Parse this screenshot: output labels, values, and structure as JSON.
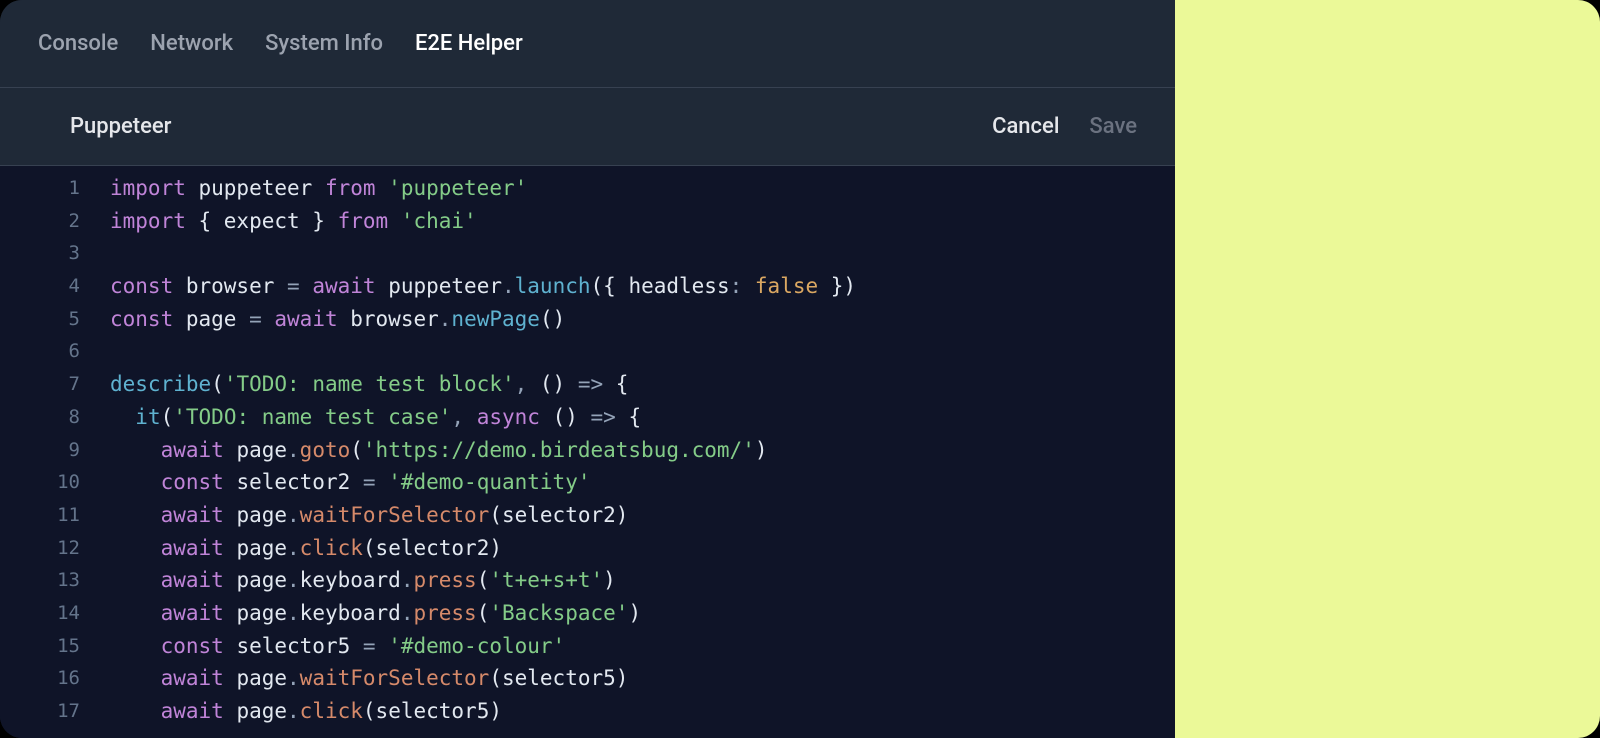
{
  "tabs": {
    "console": "Console",
    "network": "Network",
    "sysinfo": "System Info",
    "e2e": "E2E Helper",
    "activeIndex": 3
  },
  "toolbar": {
    "title": "Puppeteer",
    "cancel": "Cancel",
    "save": "Save"
  },
  "code": {
    "lineNumbers": [
      "1",
      "2",
      "3",
      "4",
      "5",
      "6",
      "7",
      "8",
      "9",
      "10",
      "11",
      "12",
      "13",
      "14",
      "15",
      "16",
      "17"
    ],
    "tokens": [
      [
        [
          "kw",
          "import"
        ],
        [
          "id",
          " puppeteer "
        ],
        [
          "kw",
          "from"
        ],
        [
          "id",
          " "
        ],
        [
          "str",
          "'puppeteer'"
        ]
      ],
      [
        [
          "kw",
          "import"
        ],
        [
          "id",
          " { expect } "
        ],
        [
          "kw",
          "from"
        ],
        [
          "id",
          " "
        ],
        [
          "str",
          "'chai'"
        ]
      ],
      [],
      [
        [
          "kw",
          "const"
        ],
        [
          "id",
          " browser "
        ],
        [
          "op",
          "="
        ],
        [
          "id",
          " "
        ],
        [
          "kw",
          "await"
        ],
        [
          "id",
          " puppeteer"
        ],
        [
          "op",
          "."
        ],
        [
          "fn",
          "launch"
        ],
        [
          "paren",
          "({ "
        ],
        [
          "id",
          "headless"
        ],
        [
          "op",
          ":"
        ],
        [
          "id",
          " "
        ],
        [
          "bool",
          "false"
        ],
        [
          "paren",
          " })"
        ]
      ],
      [
        [
          "kw",
          "const"
        ],
        [
          "id",
          " page "
        ],
        [
          "op",
          "="
        ],
        [
          "id",
          " "
        ],
        [
          "kw",
          "await"
        ],
        [
          "id",
          " browser"
        ],
        [
          "op",
          "."
        ],
        [
          "fn",
          "newPage"
        ],
        [
          "paren",
          "()"
        ]
      ],
      [],
      [
        [
          "fn",
          "describe"
        ],
        [
          "paren",
          "("
        ],
        [
          "str",
          "'TODO: name test block'"
        ],
        [
          "op",
          ","
        ],
        [
          "paren",
          " () "
        ],
        [
          "op",
          "=>"
        ],
        [
          "paren",
          " {"
        ]
      ],
      [
        [
          "id",
          "  "
        ],
        [
          "fn",
          "it"
        ],
        [
          "paren",
          "("
        ],
        [
          "str",
          "'TODO: name test case'"
        ],
        [
          "op",
          ","
        ],
        [
          "id",
          " "
        ],
        [
          "kw",
          "async"
        ],
        [
          "paren",
          " () "
        ],
        [
          "op",
          "=>"
        ],
        [
          "paren",
          " {"
        ]
      ],
      [
        [
          "id",
          "    "
        ],
        [
          "kw",
          "await"
        ],
        [
          "id",
          " page"
        ],
        [
          "op",
          "."
        ],
        [
          "method",
          "goto"
        ],
        [
          "paren",
          "("
        ],
        [
          "str",
          "'https://demo.birdeatsbug.com/'"
        ],
        [
          "paren",
          ")"
        ]
      ],
      [
        [
          "id",
          "    "
        ],
        [
          "kw",
          "const"
        ],
        [
          "id",
          " selector2 "
        ],
        [
          "op",
          "="
        ],
        [
          "id",
          " "
        ],
        [
          "str",
          "'#demo-quantity'"
        ]
      ],
      [
        [
          "id",
          "    "
        ],
        [
          "kw",
          "await"
        ],
        [
          "id",
          " page"
        ],
        [
          "op",
          "."
        ],
        [
          "method",
          "waitForSelector"
        ],
        [
          "paren",
          "("
        ],
        [
          "id",
          "selector2"
        ],
        [
          "paren",
          ")"
        ]
      ],
      [
        [
          "id",
          "    "
        ],
        [
          "kw",
          "await"
        ],
        [
          "id",
          " page"
        ],
        [
          "op",
          "."
        ],
        [
          "method",
          "click"
        ],
        [
          "paren",
          "("
        ],
        [
          "id",
          "selector2"
        ],
        [
          "paren",
          ")"
        ]
      ],
      [
        [
          "id",
          "    "
        ],
        [
          "kw",
          "await"
        ],
        [
          "id",
          " page"
        ],
        [
          "op",
          "."
        ],
        [
          "id",
          "keyboard"
        ],
        [
          "op",
          "."
        ],
        [
          "method",
          "press"
        ],
        [
          "paren",
          "("
        ],
        [
          "str",
          "'t+e+s+t'"
        ],
        [
          "paren",
          ")"
        ]
      ],
      [
        [
          "id",
          "    "
        ],
        [
          "kw",
          "await"
        ],
        [
          "id",
          " page"
        ],
        [
          "op",
          "."
        ],
        [
          "id",
          "keyboard"
        ],
        [
          "op",
          "."
        ],
        [
          "method",
          "press"
        ],
        [
          "paren",
          "("
        ],
        [
          "str",
          "'Backspace'"
        ],
        [
          "paren",
          ")"
        ]
      ],
      [
        [
          "id",
          "    "
        ],
        [
          "kw",
          "const"
        ],
        [
          "id",
          " selector5 "
        ],
        [
          "op",
          "="
        ],
        [
          "id",
          " "
        ],
        [
          "str",
          "'#demo-colour'"
        ]
      ],
      [
        [
          "id",
          "    "
        ],
        [
          "kw",
          "await"
        ],
        [
          "id",
          " page"
        ],
        [
          "op",
          "."
        ],
        [
          "method",
          "waitForSelector"
        ],
        [
          "paren",
          "("
        ],
        [
          "id",
          "selector5"
        ],
        [
          "paren",
          ")"
        ]
      ],
      [
        [
          "id",
          "    "
        ],
        [
          "kw",
          "await"
        ],
        [
          "id",
          " page"
        ],
        [
          "op",
          "."
        ],
        [
          "method",
          "click"
        ],
        [
          "paren",
          "("
        ],
        [
          "id",
          "selector5"
        ],
        [
          "paren",
          ")"
        ]
      ]
    ]
  },
  "colors": {
    "panelBg": "#1f2937",
    "editorBg": "#0f1428",
    "rightBg": "#ebf998"
  }
}
